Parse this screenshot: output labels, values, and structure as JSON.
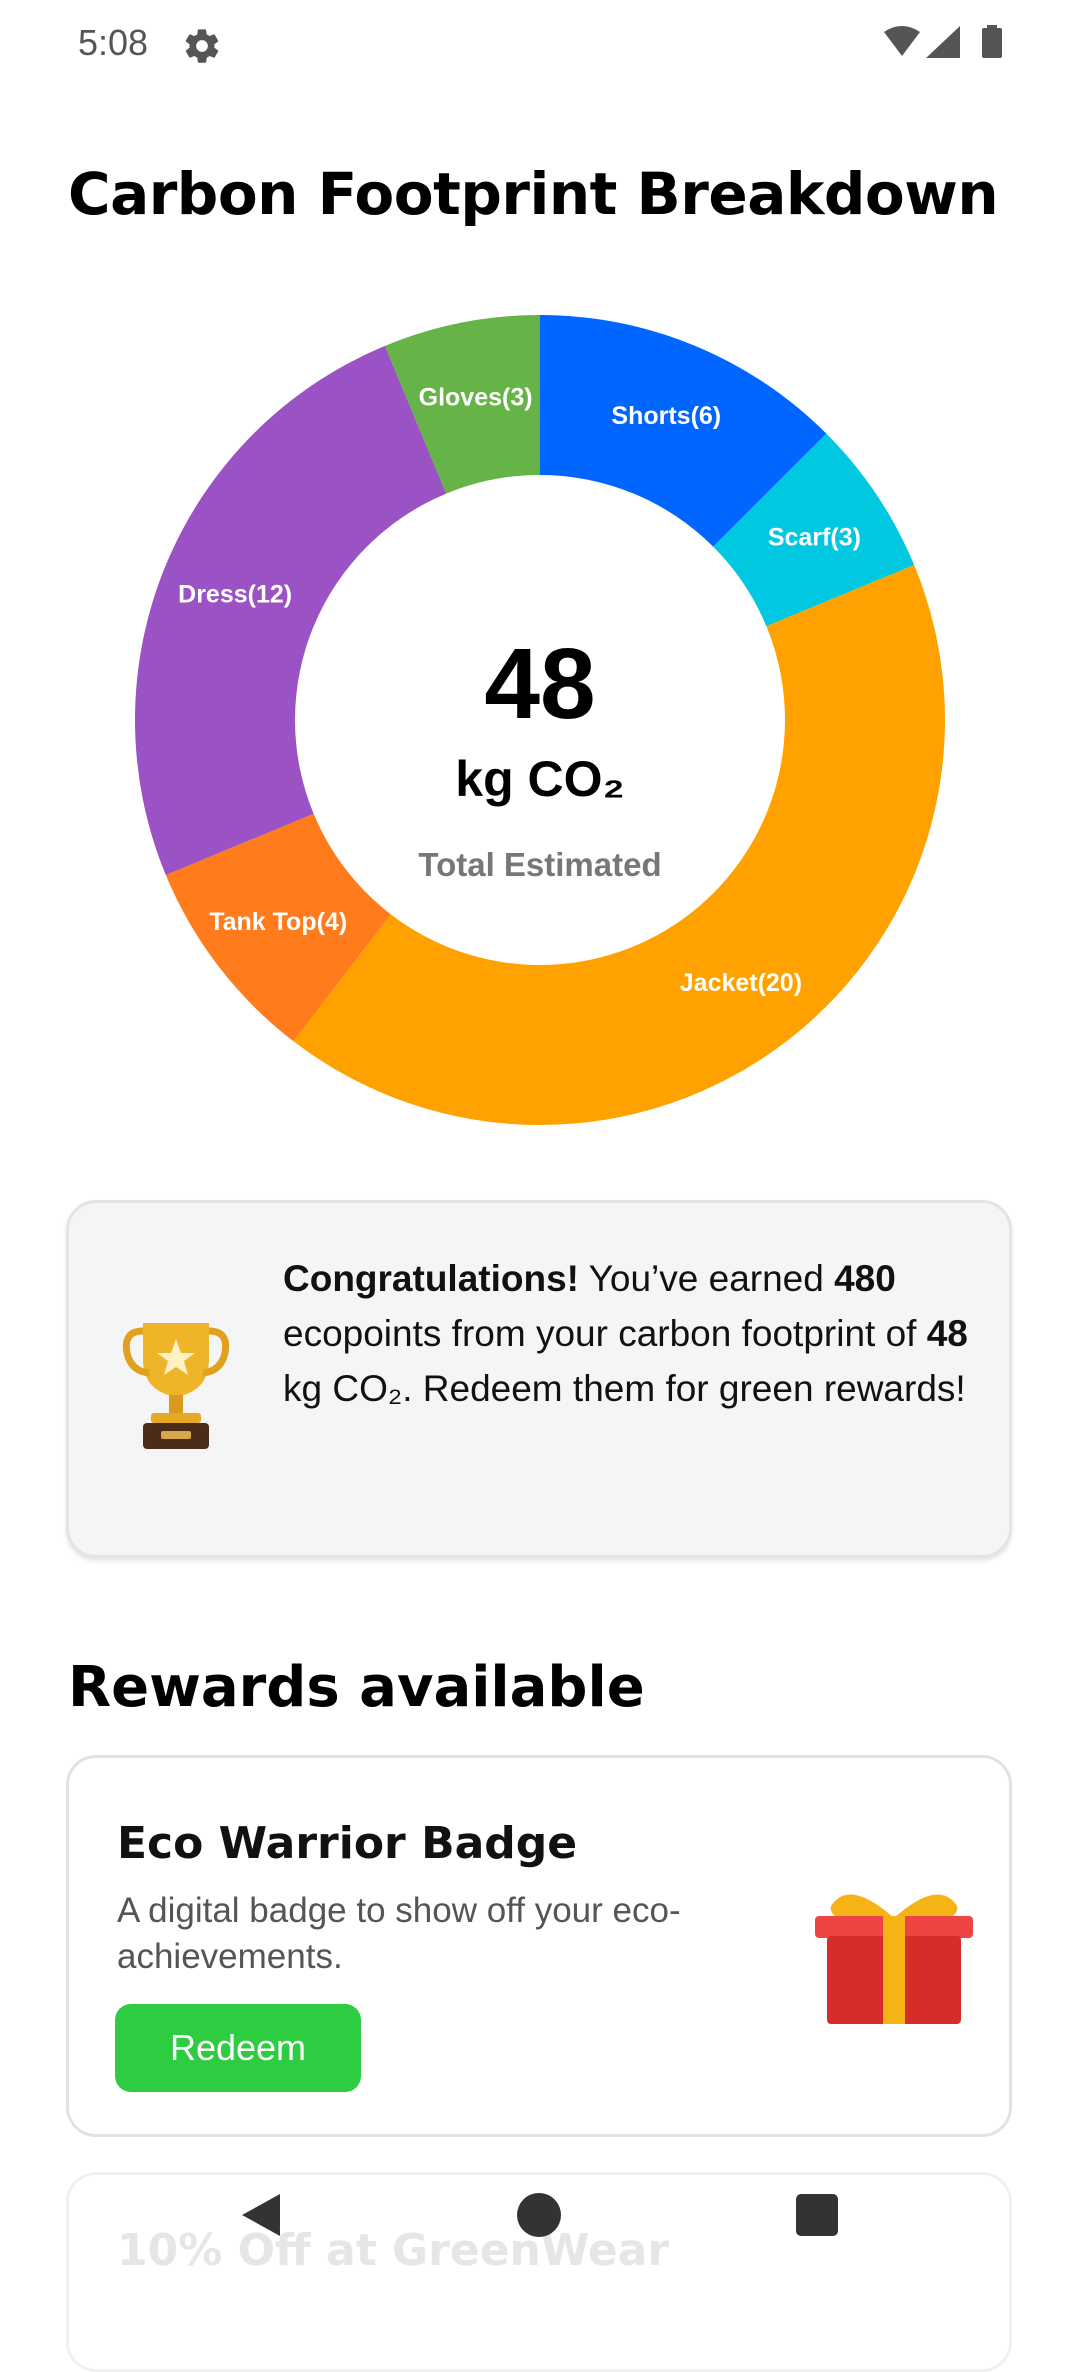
{
  "status_bar": {
    "time": "5:08",
    "icons": [
      "gear-icon",
      "wifi-icon",
      "signal-icon",
      "battery-icon"
    ]
  },
  "page": {
    "title": "Carbon Footprint Breakdown"
  },
  "chart_data": {
    "type": "pie",
    "variant": "donut",
    "title": "",
    "start_angle_deg": 0,
    "direction": "clockwise",
    "slices": [
      {
        "label": "Shorts(6)",
        "value": 6,
        "color": "#0066ff"
      },
      {
        "label": "Scarf(3)",
        "value": 3,
        "color": "#00c8e0"
      },
      {
        "label": "Jacket(20)",
        "value": 20,
        "color": "#ffa200"
      },
      {
        "label": "Tank Top(4)",
        "value": 4,
        "color": "#ff7b1c"
      },
      {
        "label": "Dress(12)",
        "value": 12,
        "color": "#9a52c4"
      },
      {
        "label": "Gloves(3)",
        "value": 3,
        "color": "#66b447"
      }
    ],
    "center": {
      "value": "48",
      "unit": "kg CO₂",
      "caption": "Total Estimated"
    }
  },
  "congrats": {
    "icon": "trophy-icon",
    "headline": "Congratulations!",
    "text_1": " You’ve earned ",
    "points": "480",
    "text_2": " ecopoints from your carbon footprint of ",
    "amount": "48",
    "text_3": " kg CO₂. Redeem them for green rewards!"
  },
  "rewards": {
    "section_title": "Rewards available",
    "items": [
      {
        "title": "Eco Warrior Badge",
        "description": "A digital badge to show off your eco-achievements.",
        "button_label": "Redeem",
        "icon": "gift-icon",
        "button_color": "#2ecc40"
      },
      {
        "title": "10% Off at GreenWear"
      }
    ]
  },
  "nav": {
    "icons": [
      "back-icon",
      "home-icon",
      "recents-icon"
    ]
  }
}
